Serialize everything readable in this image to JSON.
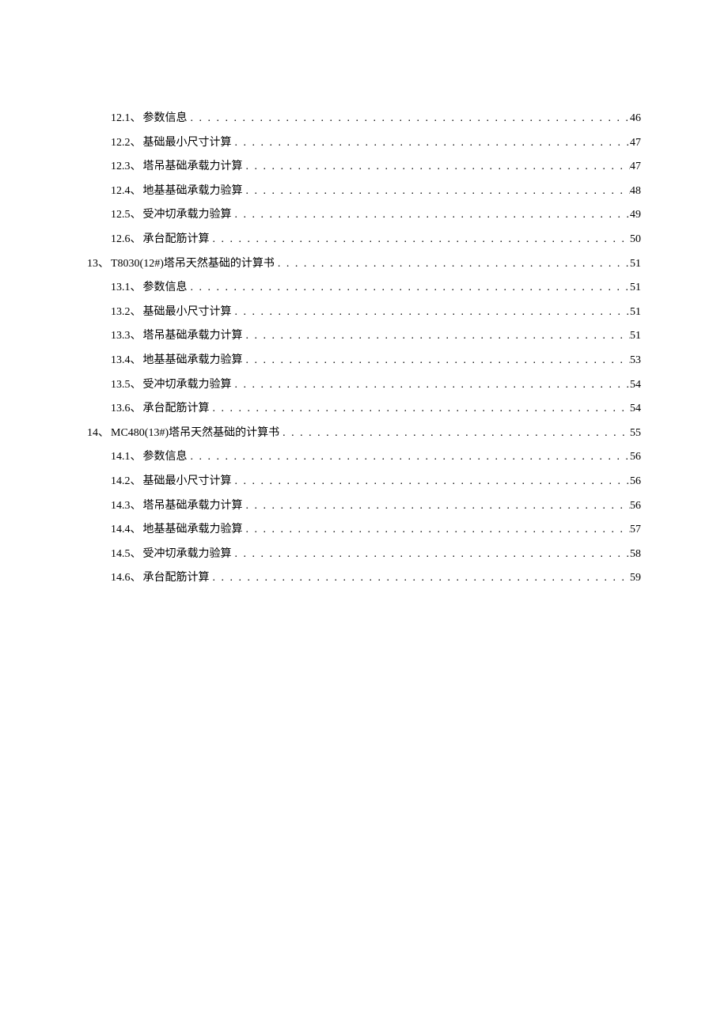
{
  "toc": {
    "entries": [
      {
        "level": "sub",
        "num": "12.1",
        "sep": "、",
        "title": "参数信息",
        "page": "46"
      },
      {
        "level": "sub",
        "num": "12.2",
        "sep": "、",
        "title": "基础最小尺寸计算",
        "page": "47"
      },
      {
        "level": "sub",
        "num": "12.3",
        "sep": "、",
        "title": "塔吊基础承载力计算",
        "page": "47"
      },
      {
        "level": "sub",
        "num": "12.4",
        "sep": "、",
        "title": "地基基础承载力验算",
        "page": "48"
      },
      {
        "level": "sub",
        "num": "12.5",
        "sep": "、",
        "title": "受冲切承载力验算",
        "page": "49"
      },
      {
        "level": "sub",
        "num": "12.6",
        "sep": "、",
        "title": "承台配筋计算",
        "page": "50"
      },
      {
        "level": "main",
        "num": "13",
        "sep": "、",
        "title": "T8030(12#)塔吊天然基础的计算书",
        "page": "51"
      },
      {
        "level": "sub",
        "num": "13.1",
        "sep": "、",
        "title": "参数信息",
        "page": "51"
      },
      {
        "level": "sub",
        "num": "13.2",
        "sep": "、",
        "title": "基础最小尺寸计算",
        "page": "51"
      },
      {
        "level": "sub",
        "num": "13.3",
        "sep": "、",
        "title": "塔吊基础承载力计算",
        "page": "51"
      },
      {
        "level": "sub",
        "num": "13.4",
        "sep": "、",
        "title": "地基基础承载力验算",
        "page": "53"
      },
      {
        "level": "sub",
        "num": "13.5",
        "sep": "、",
        "title": "受冲切承载力验算",
        "page": "54"
      },
      {
        "level": "sub",
        "num": "13.6",
        "sep": "、",
        "title": "承台配筋计算",
        "page": "54"
      },
      {
        "level": "main",
        "num": "14",
        "sep": "、",
        "title": "MC480(13#)塔吊天然基础的计算书",
        "page": "55"
      },
      {
        "level": "sub",
        "num": "14.1",
        "sep": "、",
        "title": "参数信息",
        "page": "56"
      },
      {
        "level": "sub",
        "num": "14.2",
        "sep": "、",
        "title": "基础最小尺寸计算",
        "page": "56"
      },
      {
        "level": "sub",
        "num": "14.3",
        "sep": "、",
        "title": "塔吊基础承载力计算",
        "page": "56"
      },
      {
        "level": "sub",
        "num": "14.4",
        "sep": "、",
        "title": "地基基础承载力验算",
        "page": "57"
      },
      {
        "level": "sub",
        "num": "14.5",
        "sep": "、",
        "title": "受冲切承载力验算",
        "page": "58"
      },
      {
        "level": "sub",
        "num": "14.6",
        "sep": "、",
        "title": "承台配筋计算",
        "page": "59"
      }
    ]
  }
}
